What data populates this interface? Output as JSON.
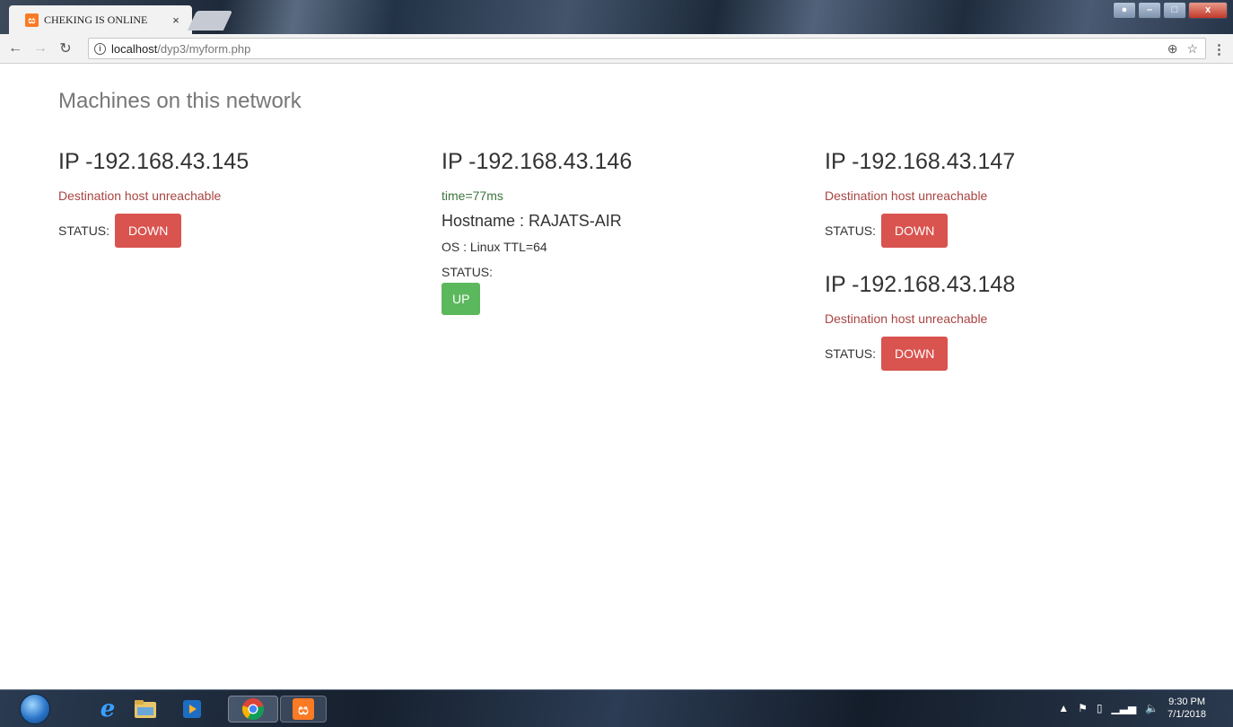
{
  "browser": {
    "tab_title": "CHEKING IS ONLINE",
    "tab_close": "×",
    "favicon_text": "ස",
    "url_host": "localhost",
    "url_path": "/dyp3/myform.php"
  },
  "page": {
    "title": "Machines on this network",
    "hosts": [
      {
        "ip": "IP -192.168.43.145",
        "message": "Destination host unreachable",
        "status_label": "STATUS:",
        "status": "DOWN"
      },
      {
        "ip": "IP -192.168.43.146",
        "message": "time=77ms",
        "hostname": "Hostname : RAJATS-AIR",
        "os": "OS : Linux TTL=64",
        "status_label": "STATUS:",
        "status": "UP"
      },
      {
        "ip": "IP -192.168.43.147",
        "message": "Destination host unreachable",
        "status_label": "STATUS:",
        "status": "DOWN"
      },
      {
        "ip": "IP -192.168.43.148",
        "message": "Destination host unreachable",
        "status_label": "STATUS:",
        "status": "DOWN"
      }
    ]
  },
  "taskbar": {
    "time": "9:30 PM",
    "date": "7/1/2018"
  },
  "colors": {
    "down": "#d9534f",
    "up": "#5cb85c",
    "error_text": "#a94442",
    "success_text": "#3c763d"
  }
}
